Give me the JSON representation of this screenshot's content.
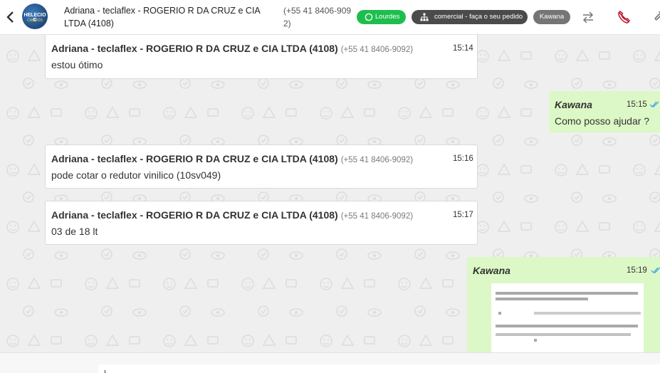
{
  "header": {
    "contact_name": "Adriana - teclaflex - ROGERIO R DA CRUZ e CIA LTDA (4108)",
    "contact_phone": "(+55 41 8406-9092)",
    "avatar_text": "HELECIO C",
    "avatar_sub": "CAMPOS",
    "tags": {
      "whatsapp": "Lourdes",
      "queue": "comercial - faça o seu pedido",
      "agent": "Kawana"
    },
    "colors": {
      "whatsapp_tag": "#1ebe4e",
      "queue_tag": "#4b4b4b",
      "agent_tag": "#757575",
      "call_icon": "#c0182f"
    },
    "icons": [
      "chevron-left-icon",
      "whatsapp-icon",
      "sitemap-icon",
      "transfer-icon",
      "end-call-icon",
      "attach-icon"
    ]
  },
  "messages": [
    {
      "sender": "Adriana - teclaflex - ROGERIO R DA CRUZ e CIA LTDA (4108)",
      "phone": "(+55 41 8406-9092)",
      "time": "15:14",
      "text": "estou ótimo"
    },
    {
      "sender": "Kawana",
      "time": "15:15",
      "text": "Como posso ajudar ?"
    },
    {
      "sender": "Adriana - teclaflex - ROGERIO R DA CRUZ e CIA LTDA (4108)",
      "phone": "(+55 41 8406-9092)",
      "time": "15:16",
      "text": "pode cotar o redutor vinilico (10sv049)"
    },
    {
      "sender": "Adriana - teclaflex - ROGERIO R DA CRUZ e CIA LTDA (4108)",
      "phone": "(+55 41 8406-9092)",
      "time": "15:17",
      "text": "03 de 18 lt"
    },
    {
      "sender": "Kawana",
      "time": "15:19",
      "text": ""
    }
  ],
  "colors": {
    "outgoing_bubble": "#dcf8c6",
    "read_check": "#4fa8e0",
    "chat_background": "#efefef"
  }
}
